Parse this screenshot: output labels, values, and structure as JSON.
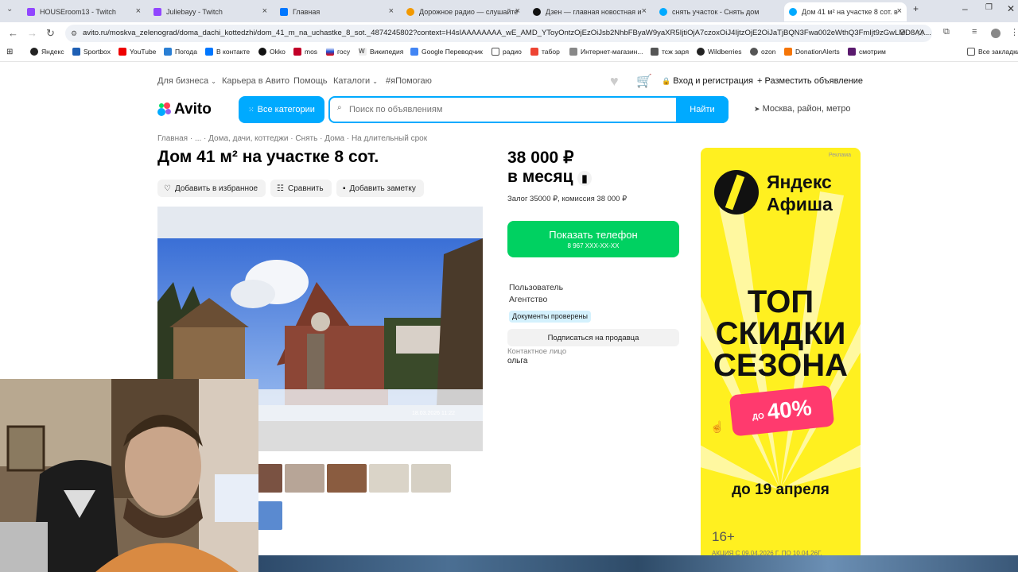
{
  "browser": {
    "tabs": [
      {
        "title": "HOUSEroom13 - Twitch",
        "color": "#9146ff"
      },
      {
        "title": "Juliebayy - Twitch",
        "color": "#9146ff"
      },
      {
        "title": "Главная",
        "color": "#0077ff"
      },
      {
        "title": "Дорожное радио — слушайте",
        "color": "#f29900"
      },
      {
        "title": "Дзен — главная новостная и",
        "color": "#111111"
      },
      {
        "title": "снять участок - Снять дом",
        "color": "#00aaff"
      },
      {
        "title": "Дом 41 м² на участке 8 сот. в",
        "color": "#00aaff"
      }
    ],
    "new_tab": "+",
    "url": "avito.ru/moskva_zelenograd/doma_dachi_kottedzhi/dom_41_m_na_uchastke_8_sot._4874245802?context=H4sIAAAAAAAA_wE_AMD_YToyOntzOjEzOiJsb2NhbFByaW9yaXR5IjtiOjA7czoxOiJ4IjtzOjE2OiJaTjBQN3Fwa002eWthQ3FmIjt9zGwLMD8AA...",
    "bookmarks": [
      "Яндекс",
      "Sportbox",
      "YouTube",
      "Погода",
      "В контакте",
      "Okko",
      "mos",
      "госу",
      "Википедия",
      "Google Переводчик",
      "радио",
      "табор",
      "Интернет-магазин...",
      "тсж заря",
      "Wildberries",
      "ozon",
      "DonationAlerts",
      "смотрим",
      "Все закладки"
    ]
  },
  "header": {
    "links": [
      "Для бизнеса",
      "Карьера в Авито",
      "Помощь",
      "Каталоги",
      "#яПомогаю"
    ],
    "login": "Вход и регистрация",
    "post_ad": "Разместить объявление",
    "logo": "Avito",
    "categories_btn": "Все категории",
    "search_placeholder": "Поиск по объявлениям",
    "search_btn": "Найти",
    "location": "Москва, район, метро"
  },
  "listing": {
    "breadcrumbs": "Главная · ... · Дома, дачи, коттеджи · Снять · Дома · На длительный срок",
    "title": "Дом 41 м² на участке 8 сот.",
    "actions": [
      "Добавить в избранное",
      "Сравнить",
      "Добавить заметку"
    ],
    "photo_timestamp": "18.03.2026 11:22",
    "price": "38 000 ₽",
    "price_period": "в месяц",
    "deposit": "Залог 35000 ₽, комиссия 38 000 ₽",
    "phone_btn": "Показать телефон",
    "phone_masked": "8 967 XXX-XX-XX",
    "seller_type": "Пользователь",
    "seller_name": "Агентство",
    "verified": "Документы проверены",
    "subscribe": "Подписаться на продавца",
    "contact_label": "Контактное лицо",
    "contact_name": "ольга"
  },
  "ad": {
    "label": "Реклама",
    "brand_line1": "Яндекс",
    "brand_line2": "Афиша",
    "headline1": "ТОП",
    "headline2": "СКИДКИ",
    "headline3": "СЕЗОНА",
    "discount_small": "ДО",
    "discount": "40%",
    "until": "до 19 апреля",
    "age": "16+",
    "footer": "АКЦИЯ С 09.04.2026 Г. ПО 10.04.26Г."
  },
  "colors": {
    "accent": "#00aaff",
    "phone": "#00d161",
    "ad_bg": "#fff020",
    "ad_pink": "#ff3a6e"
  }
}
